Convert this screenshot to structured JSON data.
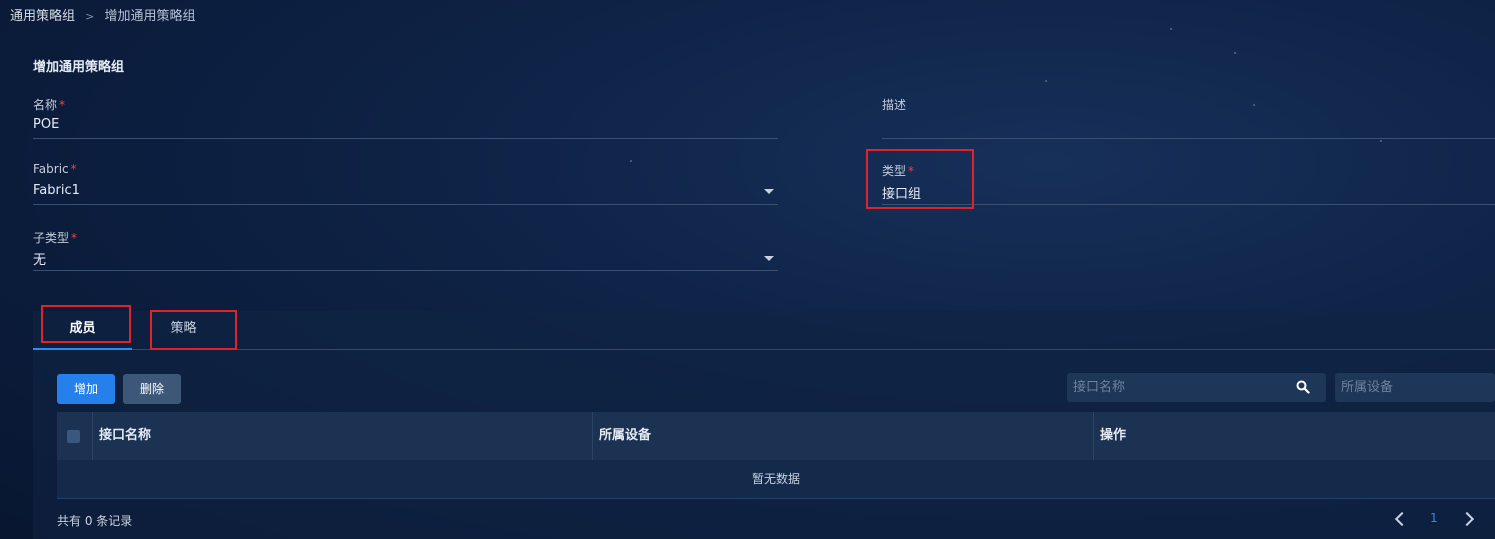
{
  "breadcrumb": {
    "root": "通用策略组",
    "separator": ">",
    "current": "增加通用策略组"
  },
  "form": {
    "title": "增加通用策略组",
    "name": {
      "label": "名称",
      "required_mark": "*",
      "value": "POE"
    },
    "description": {
      "label": "描述",
      "value": ""
    },
    "fabric": {
      "label": "Fabric",
      "required_mark": "*",
      "value": "Fabric1"
    },
    "type": {
      "label": "类型",
      "required_mark": "*",
      "value": "接口组"
    },
    "subtype": {
      "label": "子类型",
      "required_mark": "*",
      "value": "无"
    }
  },
  "tabs": [
    {
      "label": "成员",
      "active": true
    },
    {
      "label": "策略",
      "active": false
    }
  ],
  "toolbar": {
    "add_label": "增加",
    "delete_label": "删除",
    "search_interface_placeholder": "接口名称",
    "search_device_placeholder": "所属设备"
  },
  "table": {
    "columns": [
      "接口名称",
      "所属设备",
      "操作"
    ],
    "empty_text": "暂无数据"
  },
  "pagination": {
    "total_text": "共有 0 条记录",
    "current_page": "1"
  },
  "colors": {
    "accent": "#2680eb",
    "highlight_box": "#e0232a",
    "required": "#ff3b3b"
  }
}
